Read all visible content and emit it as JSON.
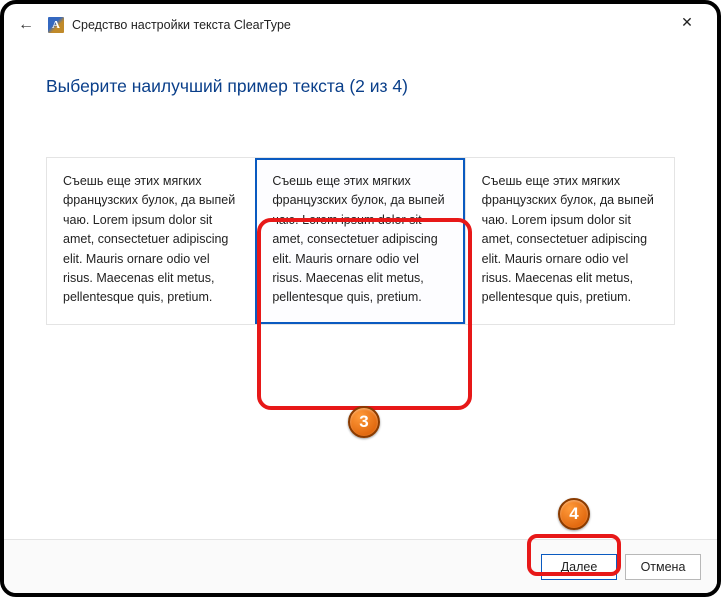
{
  "titlebar": {
    "back_icon": "←",
    "app_icon_letter": "A",
    "title": "Средство настройки текста ClearType",
    "close_icon": "✕"
  },
  "heading": "Выберите наилучший пример текста (2 из 4)",
  "samples": {
    "text": "Съешь еще этих мягких французских булок, да выпей чаю. Lorem ipsum dolor sit amet, consectetuer adipiscing elit. Mauris ornare odio vel risus. Maecenas elit metus, pellentesque quis, pretium.",
    "items": [
      {
        "selected": false
      },
      {
        "selected": true
      },
      {
        "selected": false
      }
    ]
  },
  "footer": {
    "next_label": "Далее",
    "cancel_label": "Отмена"
  },
  "annotations": {
    "badge3": "3",
    "badge4": "4"
  }
}
